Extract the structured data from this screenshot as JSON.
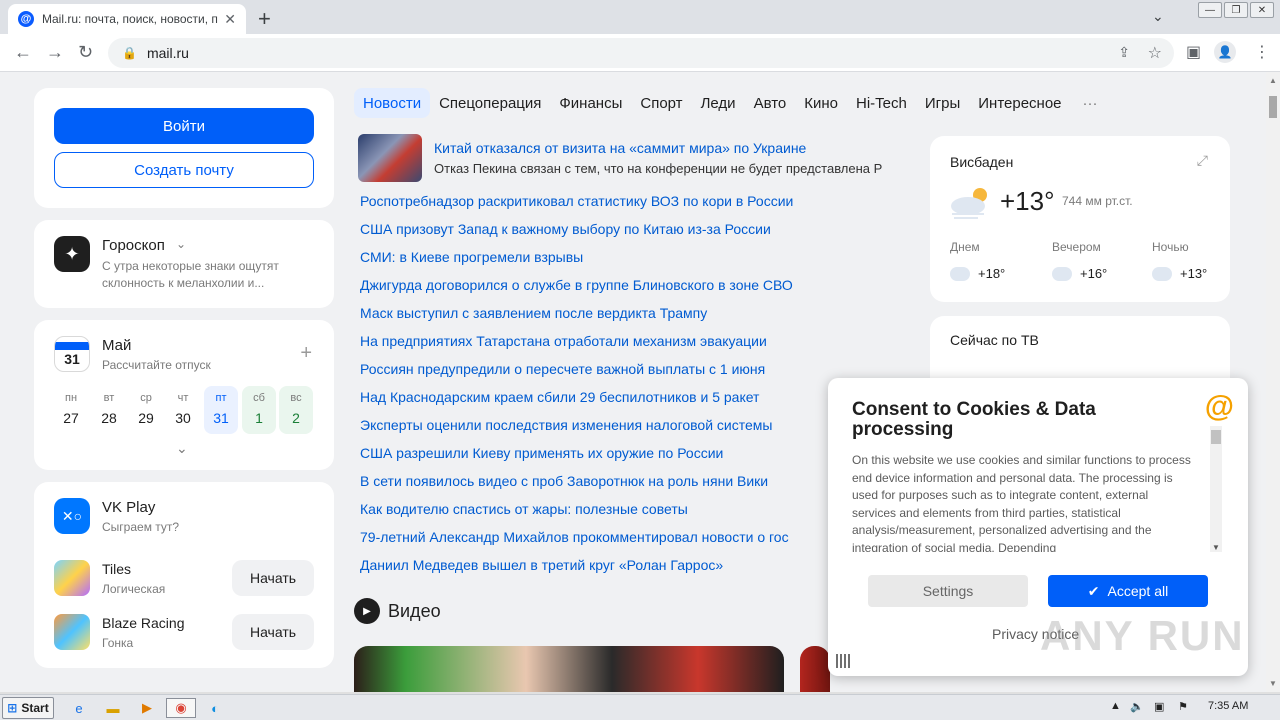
{
  "browser": {
    "tab_title": "Mail.ru: почта, поиск, новости, пр",
    "favicon": "@",
    "url": "mail.ru"
  },
  "auth": {
    "login": "Войти",
    "create": "Создать почту"
  },
  "horoscope": {
    "title": "Гороскоп",
    "text_line1": "С утра некоторые знаки ощутят",
    "text_line2": "склонность к меланхолии и..."
  },
  "calendar": {
    "icon_day": "31",
    "title": "Май",
    "subtitle": "Рассчитайте отпуск",
    "days": [
      {
        "name": "пн",
        "date": "27"
      },
      {
        "name": "вт",
        "date": "28"
      },
      {
        "name": "ср",
        "date": "29"
      },
      {
        "name": "чт",
        "date": "30"
      },
      {
        "name": "пт",
        "date": "31"
      },
      {
        "name": "сб",
        "date": "1"
      },
      {
        "name": "вс",
        "date": "2"
      }
    ]
  },
  "vkplay": {
    "title": "VK Play",
    "subtitle": "Сыграем тут?",
    "games": [
      {
        "name": "Tiles",
        "genre": "Логическая",
        "button": "Начать"
      },
      {
        "name": "Blaze Racing",
        "genre": "Гонка",
        "button": "Начать"
      }
    ]
  },
  "nav": [
    "Новости",
    "Спецоперация",
    "Финансы",
    "Спорт",
    "Леди",
    "Авто",
    "Кино",
    "Hi-Tech",
    "Игры",
    "Интересное"
  ],
  "nav_more": "···",
  "lead": {
    "headline": "Китай отказался от визита на «саммит мира» по Украине",
    "desc": "Отказ Пекина связан с тем, что на конференции не будет представлена Р"
  },
  "news": [
    "Роспотребнадзор раскритиковал статистику ВОЗ по кори в России",
    "США призовут Запад к важному выбору по Китаю из-за России",
    "СМИ: в Киеве прогремели взрывы",
    "Джигурда договорился о службе в группе Блиновского в зоне СВО",
    "Маск выступил с заявлением после вердикта Трампу",
    "На предприятиях Татарстана отработали механизм эвакуации",
    "Россиян предупредили о пересчете важной выплаты с 1 июня",
    "Над Краснодарским краем сбили 29 беспилотников и 5 ракет",
    "Эксперты оценили последствия изменения налоговой системы",
    "США разрешили Киеву применять их оружие по России",
    "В сети появилось видео с проб Заворотнюк на роль няни Вики",
    "Как водителю спастись от жары: полезные советы",
    "79-летний Александр Михайлов прокомментировал новости о гос",
    "Даниил Медведев вышел в третий круг «Ролан Гаррос»"
  ],
  "video": {
    "title": "Видео"
  },
  "weather": {
    "city": "Висбаден",
    "temp": "+13°",
    "pressure": "744 мм рт.ст.",
    "slots": [
      {
        "label": "Днем",
        "temp": "+18°"
      },
      {
        "label": "Вечером",
        "temp": "+16°"
      },
      {
        "label": "Ночью",
        "temp": "+13°"
      }
    ]
  },
  "tv": {
    "title": "Сейчас по ТВ"
  },
  "consent": {
    "title": "Consent to Cookies & Data processing",
    "body": "On this website we use cookies and similar functions to process end device information and personal data. The processing is used for purposes such as to integrate content, external services and elements from third parties, statistical analysis/measurement, personalized advertising and the integration of social media. Depending",
    "settings": "Settings",
    "accept": "Accept all",
    "privacy": "Privacy notice"
  },
  "watermark": "ANY RUN",
  "taskbar": {
    "start": "Start",
    "time": "7:35 AM"
  },
  "colors": {
    "accent": "#005ff9",
    "link": "#005bd1",
    "at_logo": "#f5a100"
  }
}
